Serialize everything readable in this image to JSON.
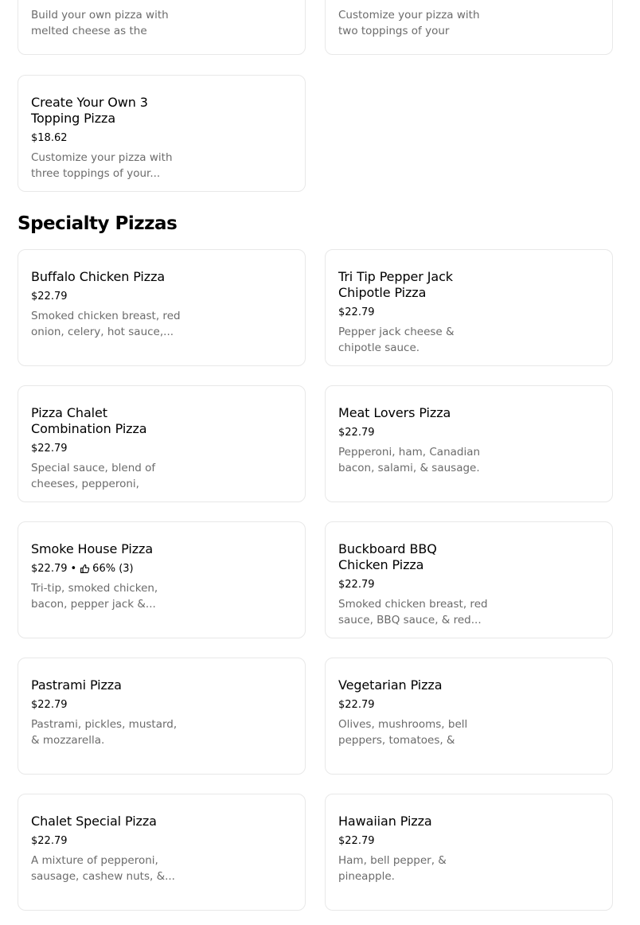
{
  "top_cards": [
    {
      "desc": "Build your own pizza with melted cheese as the base..."
    },
    {
      "desc": "Customize your pizza with two toppings of your choice!"
    }
  ],
  "create_own": {
    "name": "Create Your Own 3 Topping Pizza",
    "price": "$18.62",
    "desc": "Customize your pizza with three toppings of your..."
  },
  "section": {
    "title": "Specialty Pizzas"
  },
  "items": [
    {
      "name": "Buffalo Chicken Pizza",
      "price": "$22.79",
      "desc": "Smoked chicken breast, red onion, celery, hot sauce,..."
    },
    {
      "name": "Tri Tip Pepper Jack Chipotle Pizza",
      "price": "$22.79",
      "desc": "Pepper jack cheese & chipotle sauce."
    },
    {
      "name": "Pizza Chalet Combination Pizza",
      "price": "$22.79",
      "desc": "Special sauce, blend of cheeses, pepperoni, salam..."
    },
    {
      "name": "Meat Lovers Pizza",
      "price": "$22.79",
      "desc": "Pepperoni, ham, Canadian bacon, salami, & sausage."
    },
    {
      "name": "Smoke House Pizza",
      "price": "$22.79",
      "rating_sep": "•",
      "rating": "66% (3)",
      "rating_icon": "thumbs-up-icon",
      "desc": "Tri-tip, smoked chicken, bacon, pepper jack &..."
    },
    {
      "name": "Buckboard BBQ Chicken Pizza",
      "price": "$22.79",
      "desc": "Smoked chicken breast, red sauce, BBQ sauce, & red..."
    },
    {
      "name": "Pastrami Pizza",
      "price": "$22.79",
      "desc": "Pastrami, pickles, mustard, & mozzarella."
    },
    {
      "name": "Vegetarian Pizza",
      "price": "$22.79",
      "desc": "Olives, mushrooms, bell peppers, tomatoes, & onion."
    },
    {
      "name": "Chalet Special Pizza",
      "price": "$22.79",
      "desc": "A mixture of pepperoni, sausage, cashew nuts, &..."
    },
    {
      "name": "Hawaiian Pizza",
      "price": "$22.79",
      "desc": "Ham, bell pepper, & pineapple."
    }
  ],
  "colors": {
    "border": "#e8e8e8",
    "description": "#6b6b6b",
    "text": "#000000"
  }
}
